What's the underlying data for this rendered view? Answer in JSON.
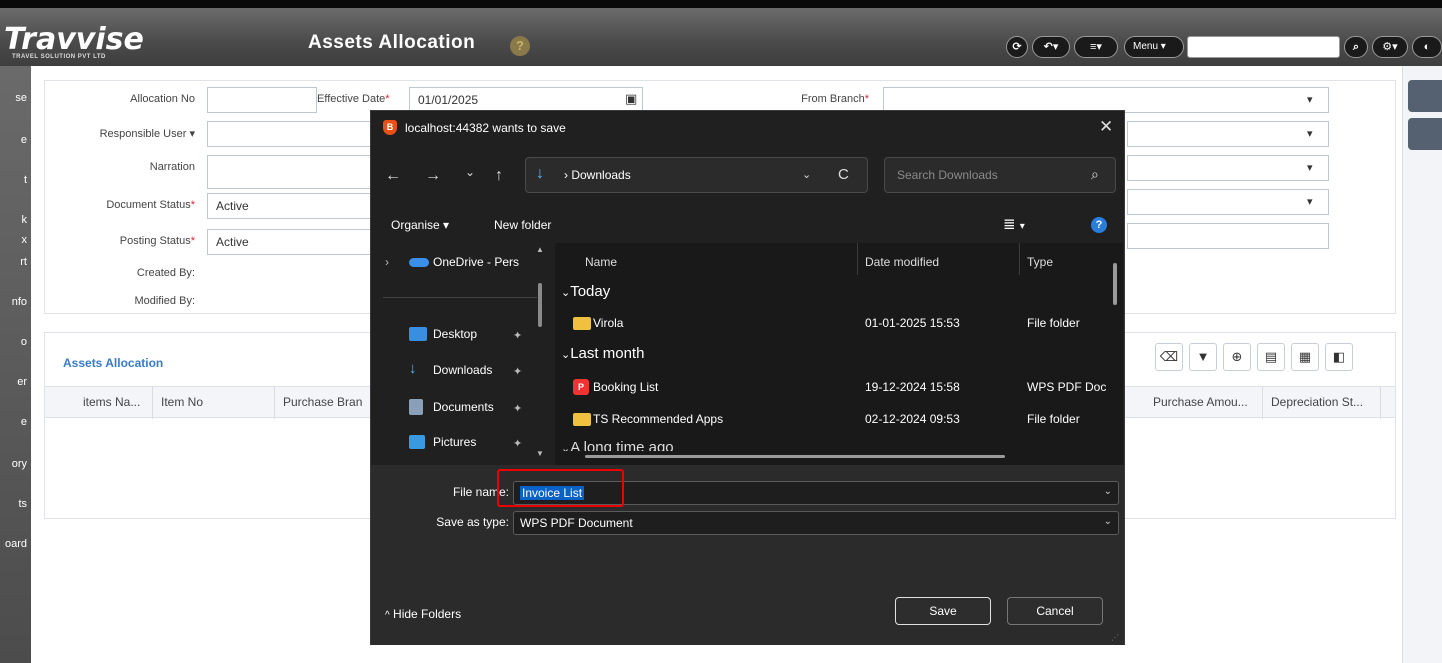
{
  "header": {
    "logo": "Travvise",
    "logo_sub": "TRAVEL SOLUTION PVT LTD",
    "title": "Assets Allocation",
    "help": "?",
    "menu_label": "Menu",
    "menu_caret": "▾",
    "search_value": ""
  },
  "sidebar": {
    "items": [
      "se",
      "e",
      "t",
      "k",
      "x",
      "rt",
      "nfo",
      "o",
      "er",
      "e",
      "ory",
      "ts",
      "oard"
    ]
  },
  "form": {
    "allocation_no_label": "Allocation No",
    "allocation_no_value": "",
    "effective_date_label": "Effective Date",
    "effective_date_value": "01/01/2025",
    "from_branch_label": "From Branch",
    "responsible_user_label": "Responsible User",
    "narration_label": "Narration",
    "document_status_label": "Document Status",
    "document_status_value": "Active",
    "posting_status_label": "Posting Status",
    "posting_status_value": "Active",
    "created_by_label": "Created By:",
    "modified_by_label": "Modified By:",
    "required_marker": "*",
    "dropdown_caret": "▾"
  },
  "grid": {
    "title": "Assets Allocation",
    "columns": [
      "items Na...",
      "Item No",
      "Purchase Bran",
      "Purchase Amou...",
      "Depreciation St..."
    ]
  },
  "dialog": {
    "title": "localhost:44382 wants to save",
    "brave_glyph": "B",
    "close": "✕",
    "nav_back": "←",
    "nav_forward": "→",
    "nav_recent": "⌄",
    "nav_up": "↑",
    "path_sep": "›",
    "path": "Downloads",
    "refresh": "C",
    "search_placeholder": "Search Downloads",
    "organise": "Organise",
    "new_folder": "New folder",
    "help": "?",
    "view_icon": "≣",
    "view_caret": "▾",
    "nav_items": [
      {
        "label": "OneDrive - Pers",
        "icon": "onedrive-icon"
      },
      {
        "label": "Desktop",
        "icon": "desktop-icon"
      },
      {
        "label": "Downloads",
        "icon": "downloads-icon"
      },
      {
        "label": "Documents",
        "icon": "documents-icon"
      },
      {
        "label": "Pictures",
        "icon": "pictures-icon"
      }
    ],
    "expand_chevron": "›",
    "pin_glyph": "✦",
    "columns": {
      "name": "Name",
      "date": "Date modified",
      "type": "Type"
    },
    "groups": {
      "today": "Today",
      "last_month": "Last month",
      "long_ago": "A long time ago"
    },
    "group_chevron": "⌄",
    "files": [
      {
        "name": "Virola",
        "date": "01-01-2025 15:53",
        "type": "File folder",
        "kind": "folder"
      },
      {
        "name": "Booking List",
        "date": "19-12-2024 15:58",
        "type": "WPS PDF Document",
        "kind": "pdf"
      },
      {
        "name": "TS Recommended Apps",
        "date": "02-12-2024 09:53",
        "type": "File folder",
        "kind": "folder"
      }
    ],
    "file_name_label": "File name:",
    "file_name_value": "Invoice List",
    "save_type_label": "Save as type:",
    "save_type_value": "WPS PDF Document",
    "field_chevron": "⌄",
    "hide_folders": "Hide Folders",
    "hide_folders_caret": "^",
    "save_button": "Save",
    "cancel_button": "Cancel"
  },
  "colors": {
    "header_bg": "#4a4a4a",
    "dialog_bg": "#202020",
    "accent_blue": "#3a7bc8",
    "selection_blue": "#0a62c7",
    "highlight_red": "#e00000"
  }
}
